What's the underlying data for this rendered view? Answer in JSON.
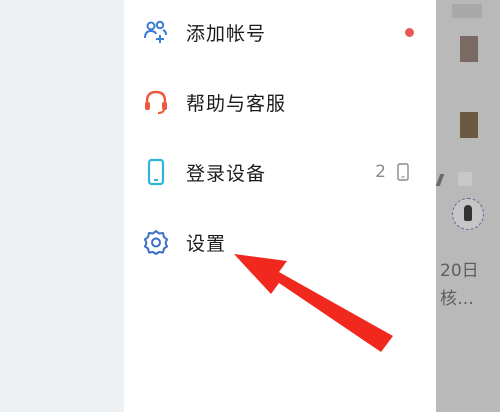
{
  "menu": {
    "items": [
      {
        "label": "添加帐号",
        "icon": "add-users-icon"
      },
      {
        "label": "帮助与客服",
        "icon": "headset-icon"
      },
      {
        "label": "登录设备",
        "icon": "phone-icon",
        "count": "2"
      },
      {
        "label": "设置",
        "icon": "gear-icon"
      }
    ]
  },
  "background": {
    "date_text": "20日",
    "snippet_text": "核…"
  },
  "colors": {
    "accent_blue": "#3a7bd5",
    "help_red": "#f0563e",
    "badge_red": "#e85a5a",
    "arrow_red": "#f0281e"
  }
}
